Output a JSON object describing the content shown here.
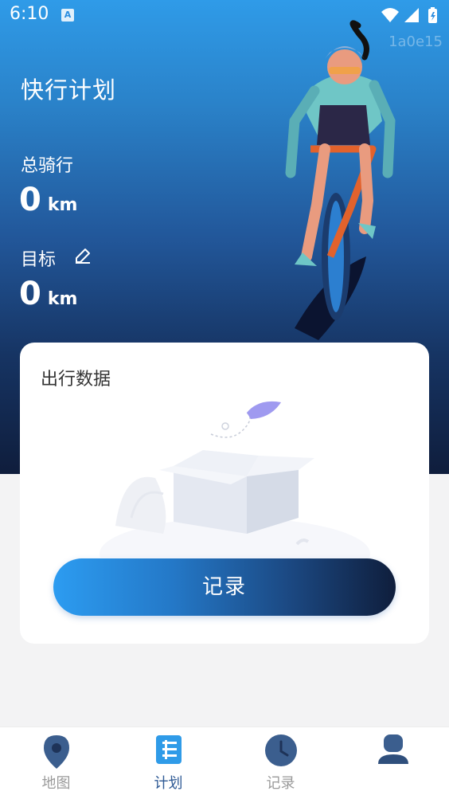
{
  "status": {
    "time": "6:10",
    "badge": "A"
  },
  "watermark": "1a0e15",
  "header": {
    "title": "快行计划"
  },
  "stats": {
    "total_label": "总骑行",
    "total_value": "0",
    "total_unit": "km",
    "goal_label": "目标",
    "goal_value": "0",
    "goal_unit": "km"
  },
  "card": {
    "title": "出行数据",
    "button_label": "记录"
  },
  "tabs": [
    {
      "label": "地图",
      "icon": "map-pin-icon"
    },
    {
      "label": "计划",
      "icon": "plan-list-icon"
    },
    {
      "label": "记录",
      "icon": "clock-icon"
    },
    {
      "label": "",
      "icon": "user-icon"
    }
  ],
  "colors": {
    "hero_top": "#2f9be8",
    "hero_bottom": "#0f1d3c",
    "tab_active": "#2f5a95",
    "tab_inactive": "#9a9a9a"
  }
}
